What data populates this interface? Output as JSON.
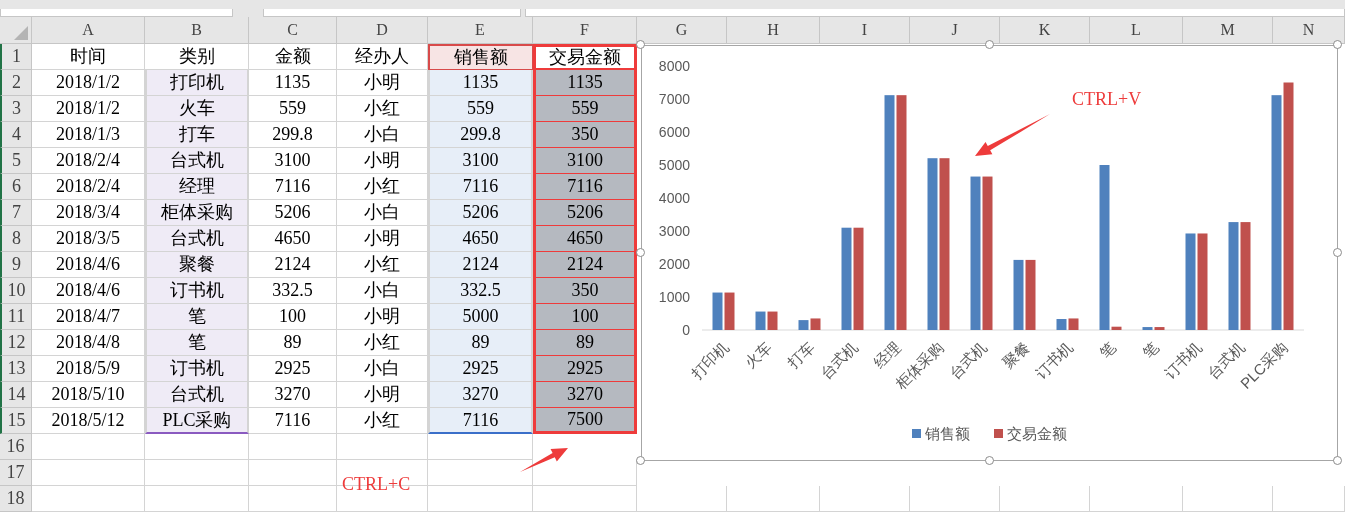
{
  "column_headers": [
    "A",
    "B",
    "C",
    "D",
    "E",
    "F",
    "G",
    "H",
    "I",
    "J",
    "K",
    "L",
    "M",
    "N"
  ],
  "row_numbers": [
    "1",
    "2",
    "3",
    "4",
    "5",
    "6",
    "7",
    "8",
    "9",
    "10",
    "11",
    "12",
    "13",
    "14",
    "15",
    "16",
    "17",
    "18"
  ],
  "table": {
    "columns": [
      {
        "label": "时间",
        "kind": "none"
      },
      {
        "label": "类别",
        "kind": "category"
      },
      {
        "label": "金额",
        "kind": "none"
      },
      {
        "label": "经办人",
        "kind": "none"
      },
      {
        "label": "销售额",
        "kind": "series"
      },
      {
        "label": "交易金额",
        "kind": "copied"
      }
    ],
    "rows": [
      [
        "2018/1/2",
        "打印机",
        "1135",
        "小明",
        "1135",
        "1135"
      ],
      [
        "2018/1/2",
        "火车",
        "559",
        "小红",
        "559",
        "559"
      ],
      [
        "2018/1/3",
        "打车",
        "299.8",
        "小白",
        "299.8",
        "350"
      ],
      [
        "2018/2/4",
        "台式机",
        "3100",
        "小明",
        "3100",
        "3100"
      ],
      [
        "2018/2/4",
        "经理",
        "7116",
        "小红",
        "7116",
        "7116"
      ],
      [
        "2018/3/4",
        "柜体采购",
        "5206",
        "小白",
        "5206",
        "5206"
      ],
      [
        "2018/3/5",
        "台式机",
        "4650",
        "小明",
        "4650",
        "4650"
      ],
      [
        "2018/4/6",
        "聚餐",
        "2124",
        "小红",
        "2124",
        "2124"
      ],
      [
        "2018/4/6",
        "订书机",
        "332.5",
        "小白",
        "332.5",
        "350"
      ],
      [
        "2018/4/7",
        "笔",
        "100",
        "小明",
        "5000",
        "100"
      ],
      [
        "2018/4/8",
        "笔",
        "89",
        "小红",
        "89",
        "89"
      ],
      [
        "2018/5/9",
        "订书机",
        "2925",
        "小白",
        "2925",
        "2925"
      ],
      [
        "2018/5/10",
        "台式机",
        "3270",
        "小明",
        "3270",
        "3270"
      ],
      [
        "2018/5/12",
        "PLC采购",
        "7116",
        "小红",
        "7116",
        "7500"
      ]
    ]
  },
  "chart": {
    "chart_data": {
      "type": "bar",
      "categories": [
        "打印机",
        "火车",
        "打车",
        "台式机",
        "经理",
        "柜体采购",
        "台式机",
        "聚餐",
        "订书机",
        "笔",
        "笔",
        "订书机",
        "台式机",
        "PLC采购"
      ],
      "series": [
        {
          "name": "销售额",
          "color": "#4f81bd",
          "values": [
            1135,
            559,
            299.8,
            3100,
            7116,
            5206,
            4650,
            2124,
            332.5,
            5000,
            89,
            2925,
            3270,
            7116
          ]
        },
        {
          "name": "交易金额",
          "color": "#c0504d",
          "values": [
            1135,
            559,
            350,
            3100,
            7116,
            5206,
            4650,
            2124,
            350,
            100,
            89,
            2925,
            3270,
            7500
          ]
        }
      ],
      "legend": "bottom",
      "ylim": [
        0,
        8000
      ],
      "yticks": [
        0,
        1000,
        2000,
        3000,
        4000,
        5000,
        6000,
        7000,
        8000
      ]
    }
  },
  "annotations": [
    {
      "kind": "paste",
      "text": "CTRL+V"
    },
    {
      "kind": "copy",
      "text": "CTRL+C"
    }
  ]
}
